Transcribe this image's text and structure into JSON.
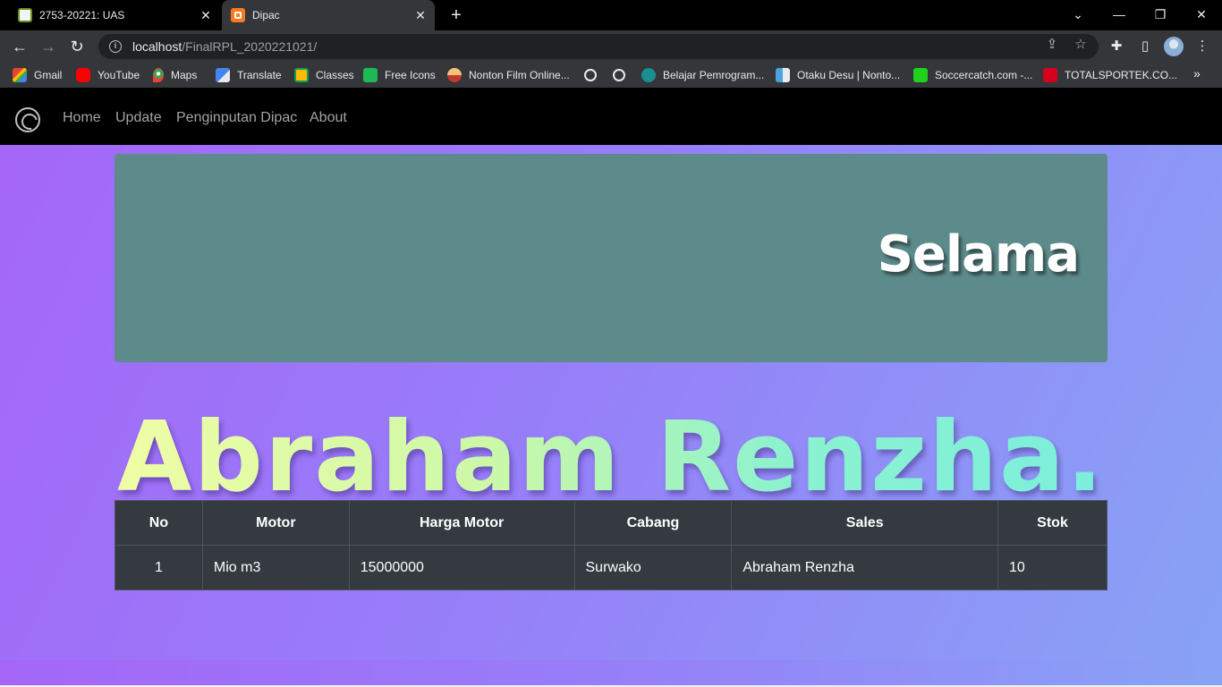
{
  "browser": {
    "tabs": [
      {
        "title": "2753-20221: UAS",
        "active": false
      },
      {
        "title": "Dipac",
        "active": true
      }
    ],
    "url_host": "localhost",
    "url_path": "/FinalRPL_2020221021/",
    "bookmarks": [
      {
        "label": "Gmail",
        "icon": "gmail-icon"
      },
      {
        "label": "YouTube",
        "icon": "youtube-icon"
      },
      {
        "label": "Maps",
        "icon": "maps-icon"
      },
      {
        "label": "Translate",
        "icon": "translate-icon"
      },
      {
        "label": "Classes",
        "icon": "classes-icon"
      },
      {
        "label": "Free Icons",
        "icon": "free-icons-icon"
      },
      {
        "label": "Nonton Film Online...",
        "icon": "film-icon"
      },
      {
        "label": "",
        "icon": "globe-icon"
      },
      {
        "label": "",
        "icon": "globe-icon"
      },
      {
        "label": "Belajar Pemrogram...",
        "icon": "belajar-icon"
      },
      {
        "label": "Otaku Desu | Nonto...",
        "icon": "otaku-icon"
      },
      {
        "label": "Soccercatch.com -...",
        "icon": "soccer-icon"
      },
      {
        "label": "TOTALSPORTEK.CO...",
        "icon": "totalsportek-icon"
      }
    ]
  },
  "page": {
    "nav": [
      "Home",
      "Update",
      "Penginputan Dipac",
      "About"
    ],
    "hero_text": "Selama",
    "big_name": "Abraham Renzha.",
    "table": {
      "headers": [
        "No",
        "Motor",
        "Harga Motor",
        "Cabang",
        "Sales",
        "Stok"
      ],
      "rows": [
        [
          "1",
          "Mio m3",
          "15000000",
          "Surwako",
          "Abraham Renzha",
          "10"
        ]
      ]
    }
  }
}
